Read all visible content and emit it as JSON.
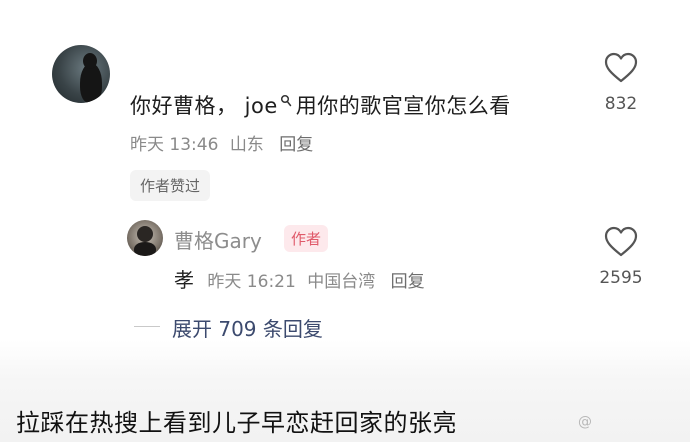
{
  "comment": {
    "text": "你好曹格， joe",
    "text_suffix": "用你的歌官宣你怎么看",
    "timestamp": "昨天 13:46",
    "region": "山东",
    "reply_label": "回复",
    "author_liked_chip": "作者赞过",
    "like_count": "832"
  },
  "reply": {
    "author_name": "曹格Gary",
    "author_badge": "作者",
    "text": "孝",
    "timestamp": "昨天 16:21",
    "region": "中国台湾",
    "reply_label": "回复",
    "like_count": "2595"
  },
  "expand": {
    "label": "展开 709 条回复"
  },
  "caption": {
    "text": "拉踩在热搜上看到儿子早恋赶回家的张亮"
  },
  "watermark": {
    "text": "@ "
  },
  "colors": {
    "badge": "#e05a6a",
    "badge_bg": "#fde9ec",
    "expand_link": "#3c4a6e",
    "meta_gray": "#8a8a8a"
  },
  "icons": {
    "like": "heart-outline-icon",
    "mention": "search-icon"
  }
}
